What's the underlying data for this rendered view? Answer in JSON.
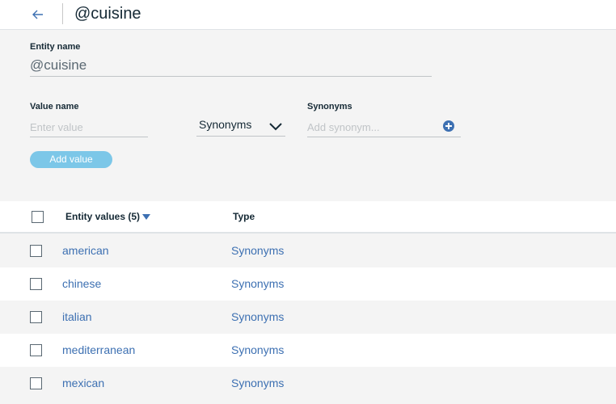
{
  "header": {
    "back_icon": "arrow-left-icon",
    "title": "@cuisine"
  },
  "form": {
    "entity_name_label": "Entity name",
    "entity_name_value": "@cuisine",
    "value_name_label": "Value name",
    "value_name_placeholder": "Enter value",
    "type_select_value": "Synonyms",
    "synonyms_label": "Synonyms",
    "synonyms_placeholder": "Add synonym...",
    "add_synonym_icon": "plus-circle-icon",
    "add_value_label": "Add value"
  },
  "table": {
    "col_values_label": "Entity values (5)",
    "col_type_label": "Type",
    "sort_icon": "caret-down-icon",
    "rows": [
      {
        "value": "american",
        "type": "Synonyms"
      },
      {
        "value": "chinese",
        "type": "Synonyms"
      },
      {
        "value": "italian",
        "type": "Synonyms"
      },
      {
        "value": "mediterranean",
        "type": "Synonyms"
      },
      {
        "value": "mexican",
        "type": "Synonyms"
      }
    ]
  },
  "colors": {
    "accent": "#3d70b2",
    "button_bg": "#7cc7e8",
    "page_bg": "#f4f4f4"
  }
}
